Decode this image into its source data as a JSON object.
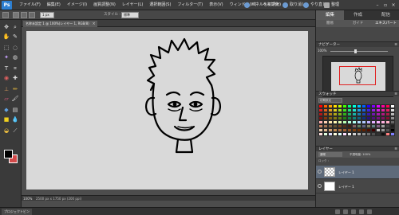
{
  "app": {
    "icon_label": "Ps"
  },
  "menu": {
    "items": [
      "ファイル(F)",
      "編集(E)",
      "イメージ(I)",
      "画質調整(N)",
      "レイヤー(L)",
      "選択範囲(S)",
      "フィルター(T)",
      "表示(V)",
      "ウィンドウ(W)",
      "ヘルプ(H)"
    ],
    "panel_undo": "パネルを初期化",
    "undo": "取り消し",
    "redo": "やり直し",
    "organizer": "整理"
  },
  "options": {
    "style_label": "スタイル :",
    "style_value": "標準",
    "size_value": "1 px"
  },
  "document": {
    "tab_title": "名称未設定 1 @ 100%(レイヤー 1, RGB/8)",
    "zoom": "100%",
    "info": "2500 px x 1750 px (200 ppi)"
  },
  "panels": {
    "main_tabs": [
      "編集",
      "作成",
      "配信"
    ],
    "sub_tabs": [
      "簡易",
      "ガイド",
      "エキスパート"
    ],
    "navigator": {
      "title": "ナビゲーター",
      "zoom": "100%"
    },
    "swatches": {
      "title": "スウォッチ",
      "preset": "初期設定"
    },
    "layers": {
      "title": "レイヤー",
      "mode": "通常",
      "opacity": "不透明度: 100%",
      "lock": "ロック :",
      "items": [
        "レイヤー 1",
        "レイヤー 1"
      ]
    }
  },
  "bottom": {
    "bin_label": "プロジェクトビン"
  },
  "colors": {
    "foreground": "#000000",
    "background": "#d24a4a",
    "accent": "#2d7fd1",
    "swatches": [
      "#ff0000",
      "#ff6000",
      "#ffa000",
      "#ffe000",
      "#c0ff00",
      "#40ff00",
      "#00ff80",
      "#00ffe0",
      "#00c0ff",
      "#0060ff",
      "#2000ff",
      "#8000ff",
      "#e000ff",
      "#ff00a0",
      "#ff0050",
      "#ffffff",
      "#e02020",
      "#e06020",
      "#e0a020",
      "#e0d020",
      "#a0e020",
      "#40e020",
      "#20e080",
      "#20e0d0",
      "#20a0e0",
      "#2060e0",
      "#4020e0",
      "#9020e0",
      "#d020e0",
      "#e020a0",
      "#e02060",
      "#e0e0e0",
      "#b01818",
      "#b05018",
      "#b08018",
      "#b0a818",
      "#80b018",
      "#30b018",
      "#18b068",
      "#18b0a8",
      "#1880b0",
      "#1848b0",
      "#3818b0",
      "#7018b0",
      "#a818b0",
      "#b01880",
      "#b01848",
      "#b8b8b8",
      "#801010",
      "#803810",
      "#806010",
      "#807810",
      "#608010",
      "#208010",
      "#108048",
      "#108078",
      "#106080",
      "#103080",
      "#281080",
      "#501080",
      "#781080",
      "#801060",
      "#801030",
      "#909090",
      "#ffb0b0",
      "#ffd0b0",
      "#ffe8b0",
      "#fff8b0",
      "#e0ffb0",
      "#b8ffb0",
      "#b0ffd8",
      "#b0fff0",
      "#b0e0ff",
      "#b0c8ff",
      "#c0b0ff",
      "#e0b0ff",
      "#f8b0ff",
      "#ffb0e0",
      "#ffb0c8",
      "#686868",
      "#c08060",
      "#a07050",
      "#806040",
      "#605030",
      "#704020",
      "#503018",
      "#402010",
      "#806060",
      "#608060",
      "#606080",
      "#808060",
      "#608080",
      "#806080",
      "#a0a0a0",
      "#404040",
      "#202020",
      "#f0d0b0",
      "#e0b890",
      "#d0a070",
      "#c08850",
      "#b07040",
      "#a06030",
      "#905020",
      "#804010",
      "#703000",
      "#602000",
      "#501000",
      "#400000",
      "#cccccc",
      "#999999",
      "#555555",
      "#000000",
      "#ffe0e0",
      "#e0ffe0",
      "#e0e0ff",
      "#ffffe0",
      "#e0ffff",
      "#ffe0ff",
      "#f0f0f0",
      "#d0d0d0",
      "#b0b0b0",
      "#909090",
      "#707070",
      "#505050",
      "#303030",
      "#101010",
      "#ff8080",
      "#8080ff"
    ]
  }
}
